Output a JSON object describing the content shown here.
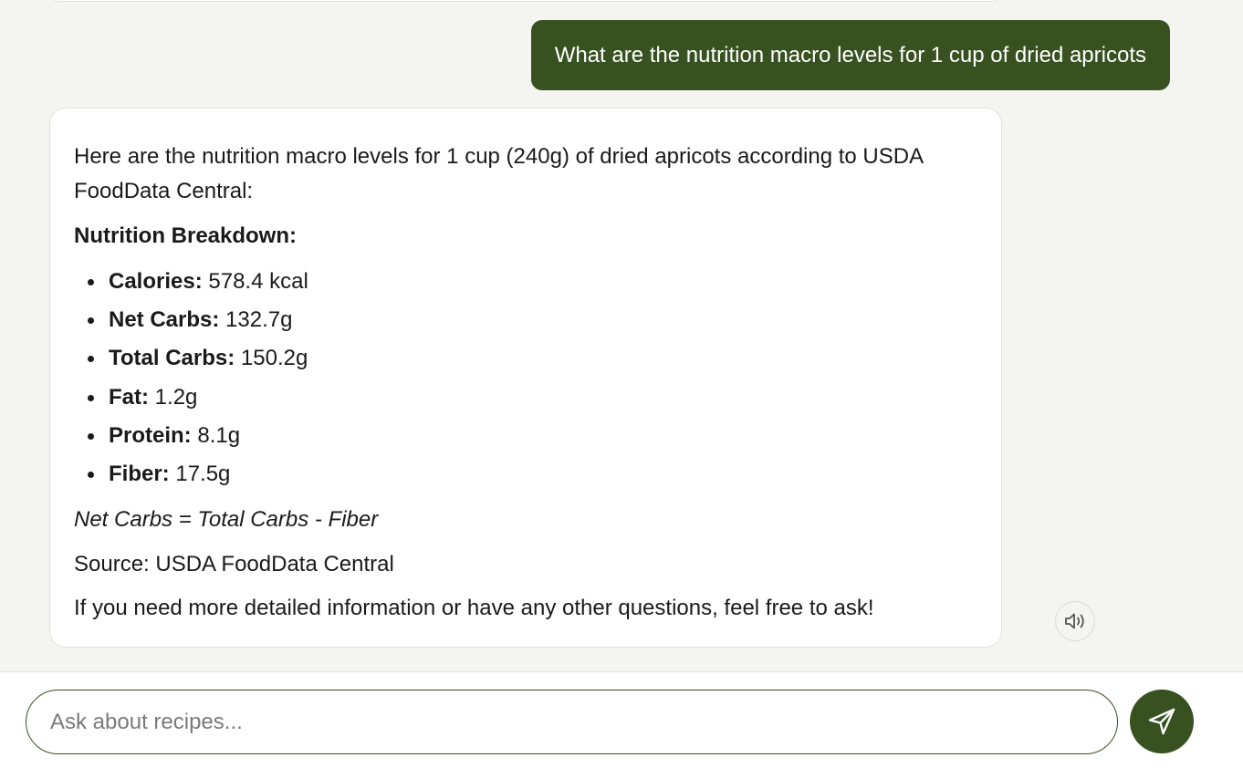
{
  "conversation": {
    "user_message": "What are the nutrition macro levels for 1 cup of dried apricots",
    "assistant": {
      "intro": "Here are the nutrition macro levels for 1 cup (240g) of dried apricots according to USDA FoodData Central:",
      "heading": "Nutrition Breakdown:",
      "items": [
        {
          "label": "Calories:",
          "value": "578.4 kcal"
        },
        {
          "label": "Net Carbs:",
          "value": "132.7g"
        },
        {
          "label": "Total Carbs:",
          "value": "150.2g"
        },
        {
          "label": "Fat:",
          "value": "1.2g"
        },
        {
          "label": "Protein:",
          "value": "8.1g"
        },
        {
          "label": "Fiber:",
          "value": "17.5g"
        }
      ],
      "note": "Net Carbs = Total Carbs - Fiber",
      "source": "Source: USDA FoodData Central",
      "closing": "If you need more detailed information or have any other questions, feel free to ask!"
    },
    "speaker_icon": "speaker-icon"
  },
  "composer": {
    "placeholder": "Ask about recipes...",
    "value": "",
    "send_icon": "send-icon"
  },
  "colors": {
    "accent": "#375220",
    "background": "#f4f4f0",
    "bubble": "#ffffff"
  }
}
